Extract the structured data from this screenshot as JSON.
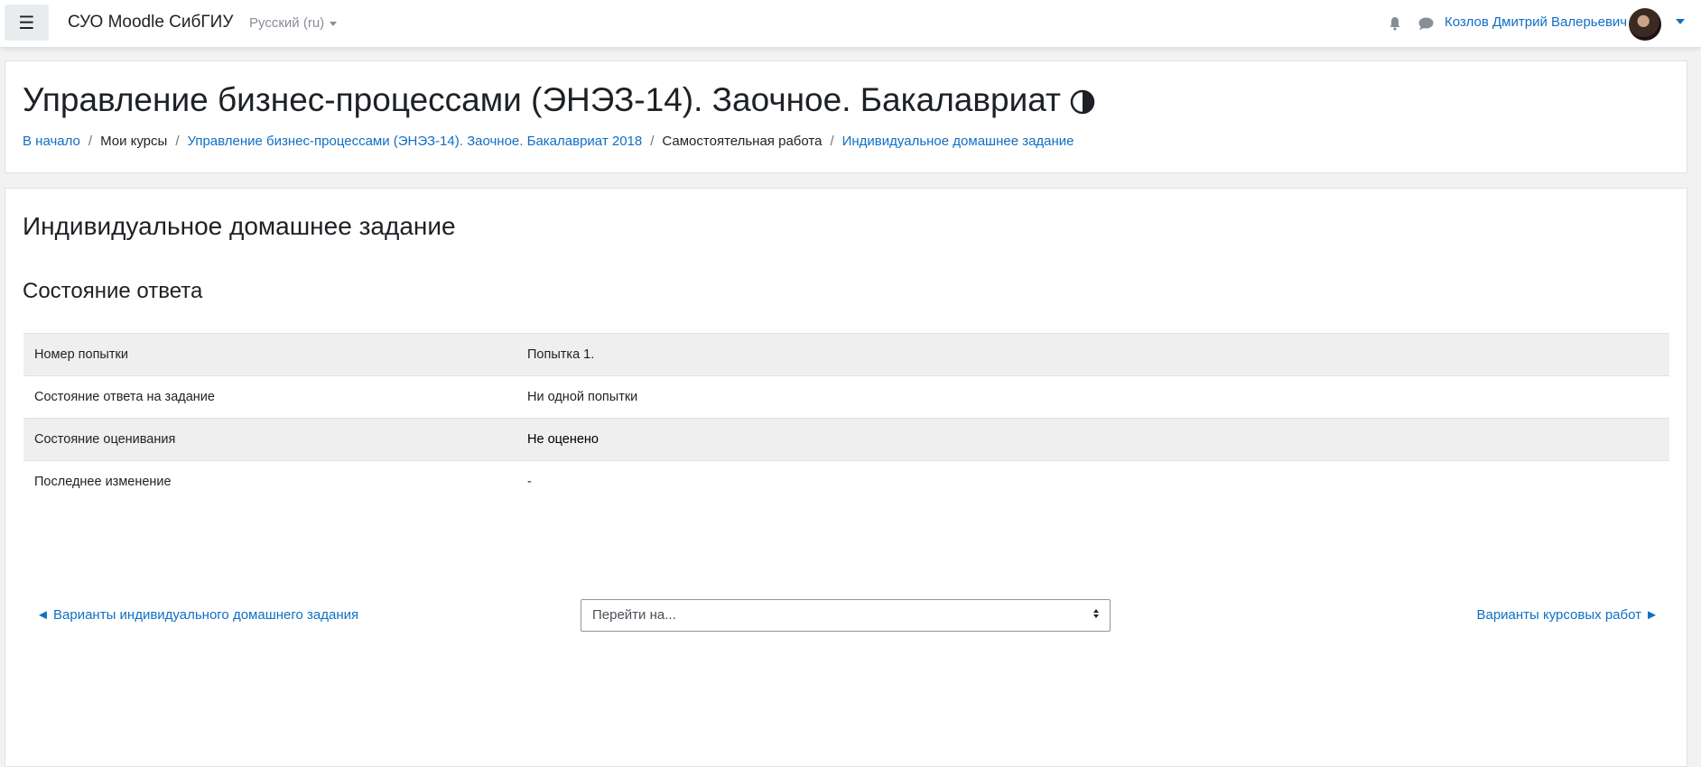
{
  "navbar": {
    "menu_icon": "hamburger-icon",
    "site_name": "СУО Moodle СибГИУ",
    "language": "Русский (ru)",
    "notifications_icon": "bell-icon",
    "messages_icon": "chat-icon",
    "user_name": "Козлов Дмитрий Валерьевич",
    "accent_color": "#0f6fc5"
  },
  "header": {
    "course_title": "Управление бизнес-процессами (ЭНЭЗ-14). Заочное. Бакалавриат",
    "title_icon": "half-circle-icon",
    "breadcrumb": [
      {
        "label": "В начало",
        "link": true
      },
      {
        "label": "Мои курсы",
        "link": false
      },
      {
        "label": "Управление бизнес-процессами (ЭНЭЗ-14). Заочное. Бакалавриат 2018",
        "link": true
      },
      {
        "label": "Самостоятельная работа",
        "link": false
      },
      {
        "label": "Индивидуальное домашнее задание",
        "link": true
      }
    ]
  },
  "main": {
    "page_title": "Индивидуальное домашнее задание",
    "section_title": "Состояние ответа",
    "status_rows": [
      {
        "label": "Номер попытки",
        "value": "Попытка 1."
      },
      {
        "label": "Состояние ответа на задание",
        "value": "Ни одной попытки"
      },
      {
        "label": "Состояние оценивания",
        "value": "Не оценено"
      },
      {
        "label": "Последнее изменение",
        "value": "-"
      }
    ],
    "prev_link": "◄ Варианты индивидуального домашнего задания",
    "jump_placeholder": "Перейти на...",
    "next_link": "Варианты курсовых работ ►"
  }
}
